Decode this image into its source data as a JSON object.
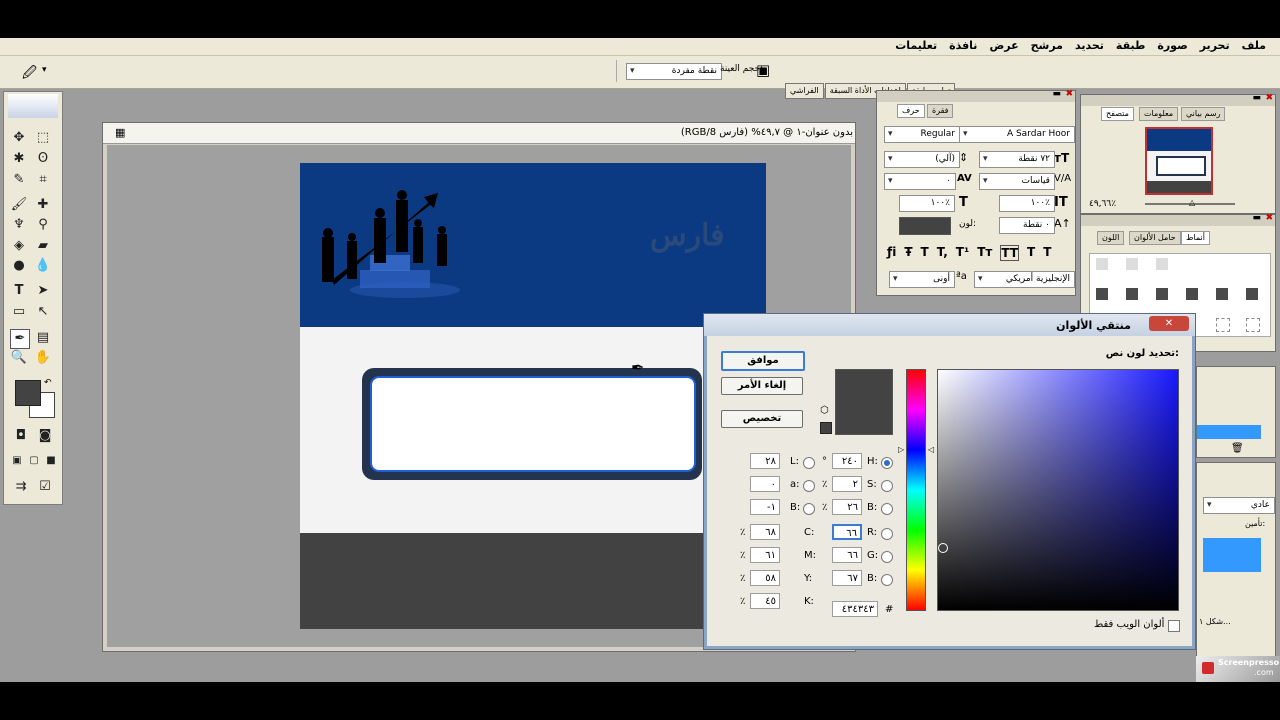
{
  "menu": [
    "ملف",
    "تحرير",
    "صورة",
    "طبقة",
    "تحديد",
    "مرشح",
    "عرض",
    "نافذة",
    "تعليمات"
  ],
  "options_bar": {
    "sample_size_label": "حجم العينة:",
    "sample_size_value": "نقطة مفردة"
  },
  "panel_wells": [
    "ترابت طبقة",
    "إعدادات الأداة السبقة",
    "الفراشي"
  ],
  "document": {
    "title": "بدون عنوان-١ @ ٤٩,٧% (فارس RGB/8)",
    "canvas_text": "فارس"
  },
  "character_panel": {
    "tabs": [
      "حرف",
      "فقرة"
    ],
    "font_family": "A Sardar Hoor",
    "font_style": "Regular",
    "font_size": "٧٢ نقطة",
    "leading": "(آلي)",
    "kerning": "قياسات",
    "tracking": "٠",
    "vscale": "١٠٠٪",
    "hscale": "١٠٠٪",
    "baseline": "٠ نقطة",
    "color_label": "لون:",
    "language": "الإنجليزية أمريكي",
    "antialias": "أونى"
  },
  "navigator_panel": {
    "tabs": [
      "رسم بياني",
      "معلومات",
      "متصفح"
    ],
    "zoom": "٤٩,٦٦٪"
  },
  "swatches_panel": {
    "tabs": [
      "أنماط",
      "حامل الألوان",
      "اللون"
    ]
  },
  "layers_panel": {
    "blend_mode": "عادي",
    "lock_label": "تأمين:",
    "layer_name": "شكل ١..."
  },
  "color_picker": {
    "title": "منتقي الألوان",
    "subtitle": "تحديد لون نص:",
    "ok_label": "موافق",
    "cancel_label": "إلغاء الأمر",
    "custom_label": "تخصيص",
    "hsb": [
      {
        "label": "H:",
        "value": "٢٤٠",
        "unit": "°"
      },
      {
        "label": "S:",
        "value": "٢",
        "unit": "٪"
      },
      {
        "label": "B:",
        "value": "٢٦",
        "unit": "٪"
      }
    ],
    "rgb": [
      {
        "label": "R:",
        "value": "٦٦"
      },
      {
        "label": "G:",
        "value": "٦٦"
      },
      {
        "label": "B:",
        "value": "٦٧"
      }
    ],
    "lab": [
      {
        "label": "L:",
        "value": "٢٨"
      },
      {
        "label": "a:",
        "value": "٠"
      },
      {
        "label": "B:",
        "value": "-١"
      }
    ],
    "cmyk": [
      {
        "label": "C:",
        "value": "٦٨",
        "unit": "٪"
      },
      {
        "label": "M:",
        "value": "٦١",
        "unit": "٪"
      },
      {
        "label": "Y:",
        "value": "٥٨",
        "unit": "٪"
      },
      {
        "label": "K:",
        "value": "٤٥",
        "unit": "٪"
      }
    ],
    "hex_label": "#",
    "hex_value": "٤٣٤٣٤٣",
    "web_only_label": "ألوان الويب فقط",
    "selected_color": "#434343"
  },
  "watermark": {
    "brand": "Screenpresso",
    "domain": ".com"
  },
  "colors": {
    "canvas_header": "#0b3a82",
    "canvas_footer": "#424242",
    "frame": "#24344e",
    "app_bg": "#9d9d9d"
  }
}
